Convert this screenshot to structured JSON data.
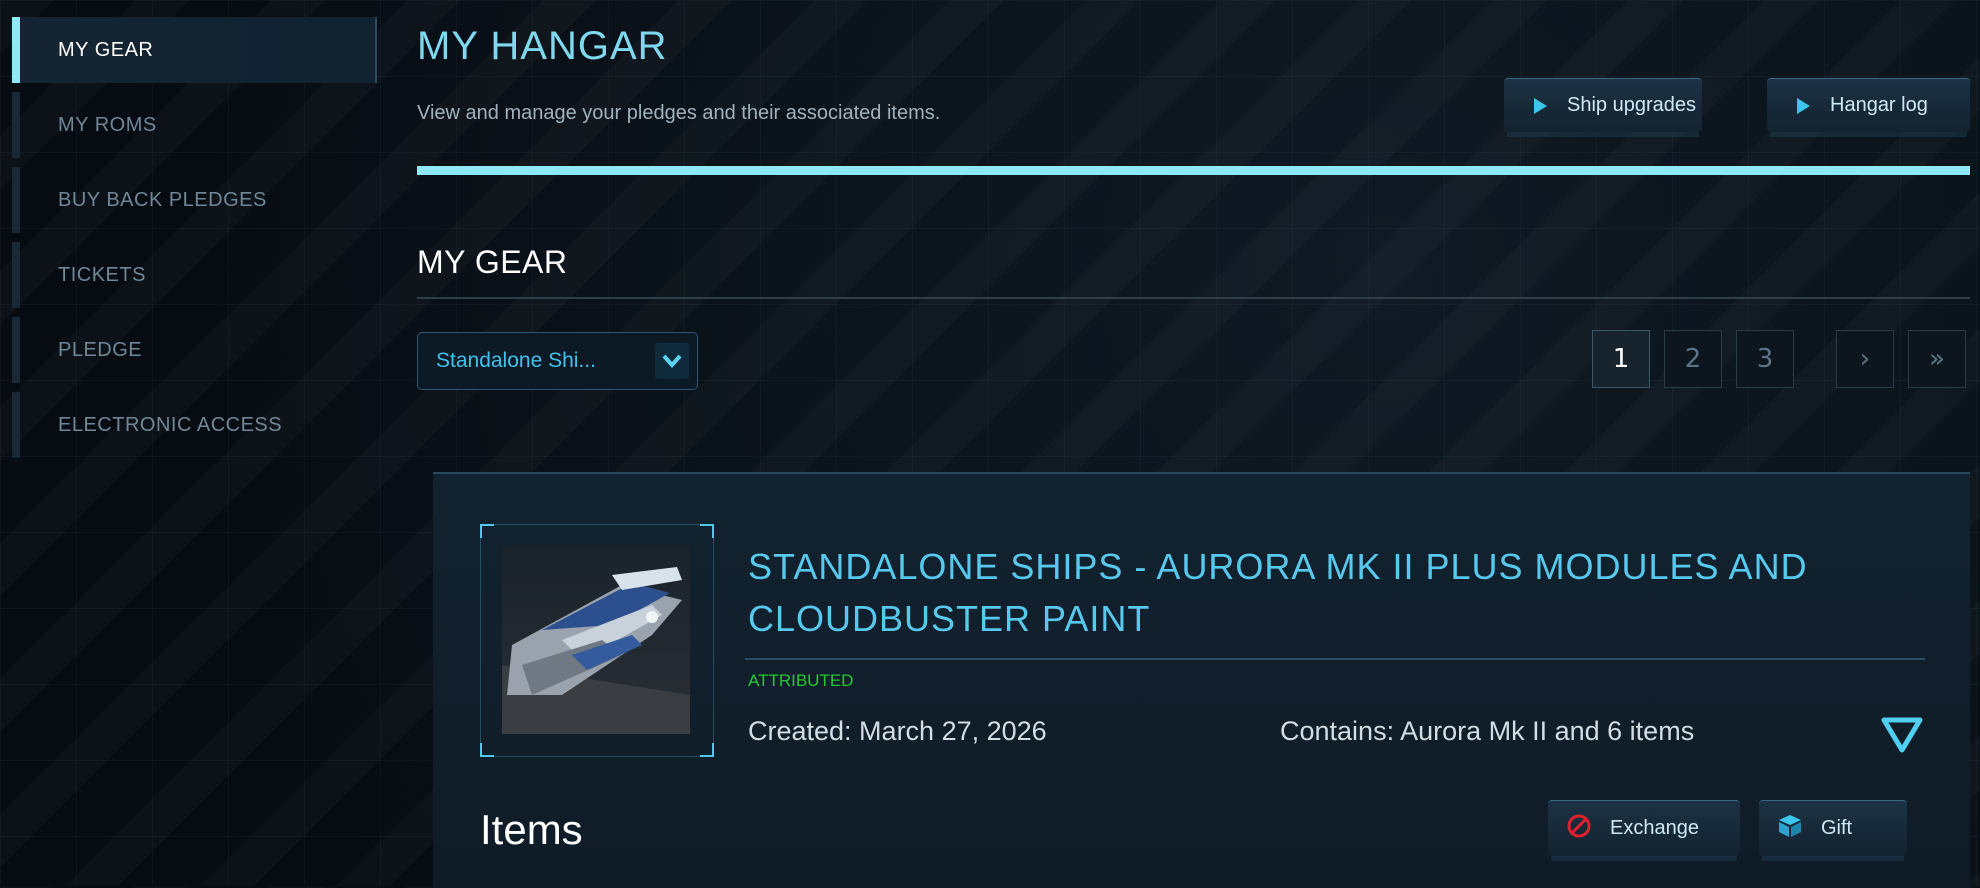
{
  "sidebar": {
    "items": [
      {
        "label": "MY GEAR",
        "active": true
      },
      {
        "label": "MY ROMS",
        "active": false
      },
      {
        "label": "BUY BACK PLEDGES",
        "active": false
      },
      {
        "label": "TICKETS",
        "active": false
      },
      {
        "label": "PLEDGE",
        "active": false
      },
      {
        "label": "ELECTRONIC ACCESS",
        "active": false
      }
    ]
  },
  "header": {
    "title": "MY HANGAR",
    "subtitle": "View and manage your pledges and their associated items.",
    "buttons": [
      {
        "label": "Ship upgrades",
        "icon": "play-icon"
      },
      {
        "label": "Hangar log",
        "icon": "play-icon"
      }
    ]
  },
  "section": {
    "title": "MY GEAR",
    "filter_value": "Standalone Shi..."
  },
  "pagination": {
    "pages": [
      "1",
      "2",
      "3"
    ],
    "current": "1",
    "next": "›",
    "last": "»"
  },
  "pledge": {
    "title": "STANDALONE SHIPS - AURORA MK II PLUS MODULES AND CLOUDBUSTER PAINT",
    "status": "ATTRIBUTED",
    "created": "Created: March 27, 2026",
    "contains": "Contains: Aurora Mk II and 6 items",
    "items_heading": "Items",
    "actions": [
      {
        "label": "Exchange",
        "icon": "no-entry-icon"
      },
      {
        "label": "Gift",
        "icon": "gift-cube-icon"
      }
    ]
  },
  "colors": {
    "accent": "#8ee8f6",
    "title_blue": "#58c9ee",
    "status_green": "#22c933"
  }
}
